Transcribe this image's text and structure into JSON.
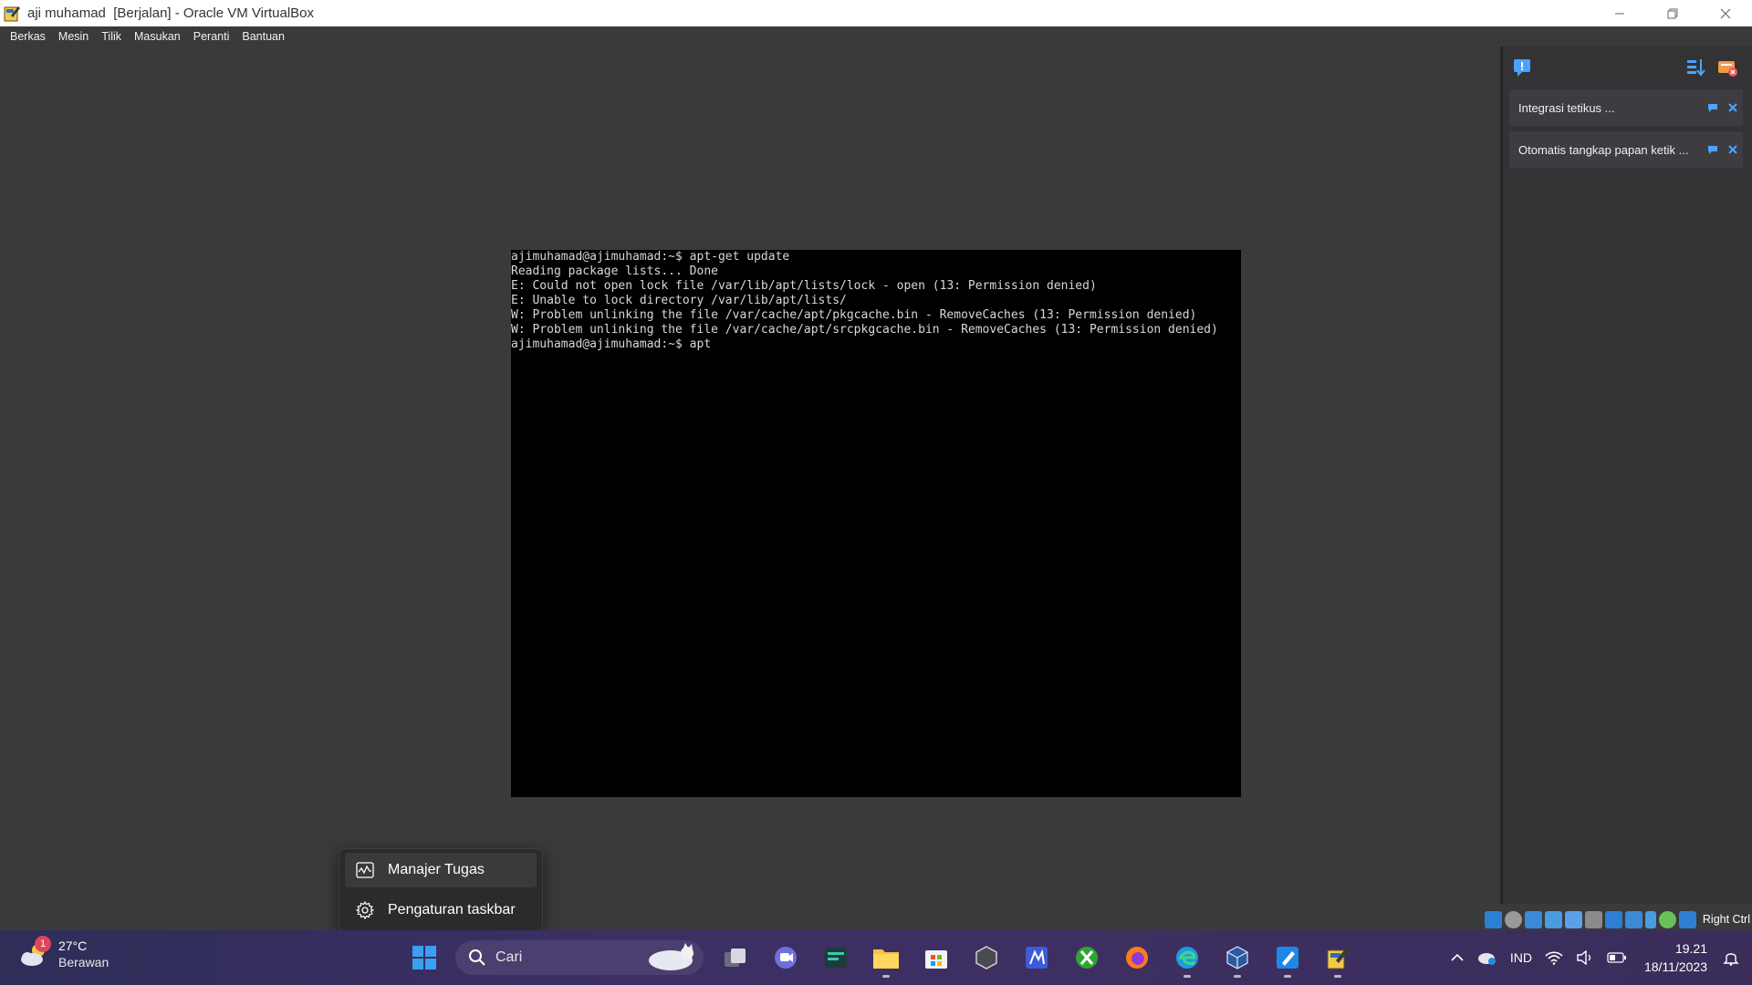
{
  "window": {
    "title": "aji muhamad  [Berjalan] - Oracle VM VirtualBox"
  },
  "menu": [
    "Berkas",
    "Mesin",
    "Tilik",
    "Masukan",
    "Peranti",
    "Bantuan"
  ],
  "terminal": {
    "lines": [
      "ajimuhamad@ajimuhamad:~$ apt-get update",
      "Reading package lists... Done",
      "E: Could not open lock file /var/lib/apt/lists/lock - open (13: Permission denied)",
      "E: Unable to lock directory /var/lib/apt/lists/",
      "W: Problem unlinking the file /var/cache/apt/pkgcache.bin - RemoveCaches (13: Permission denied)",
      "W: Problem unlinking the file /var/cache/apt/srcpkgcache.bin - RemoveCaches (13: Permission denied)",
      "ajimuhamad@ajimuhamad:~$ apt"
    ]
  },
  "notifications": [
    {
      "text": "Integrasi tetikus ..."
    },
    {
      "text": "Otomatis tangkap papan ketik ..."
    }
  ],
  "status_bar": {
    "host_key": "Right Ctrl"
  },
  "context_menu": {
    "items": [
      {
        "label": "Manajer Tugas",
        "icon": "task-manager-icon"
      },
      {
        "label": "Pengaturan taskbar",
        "icon": "gear-icon"
      }
    ]
  },
  "weather": {
    "badge": "1",
    "temp": "27°C",
    "condition": "Berawan"
  },
  "taskbar": {
    "search_label": "Cari"
  },
  "tray": {
    "language": "IND",
    "time": "19.21",
    "date": "18/11/2023"
  },
  "colors": {
    "accent": "#4aa3ff",
    "terminal_bg": "#000000",
    "vm_bg": "#3a3a3c"
  }
}
